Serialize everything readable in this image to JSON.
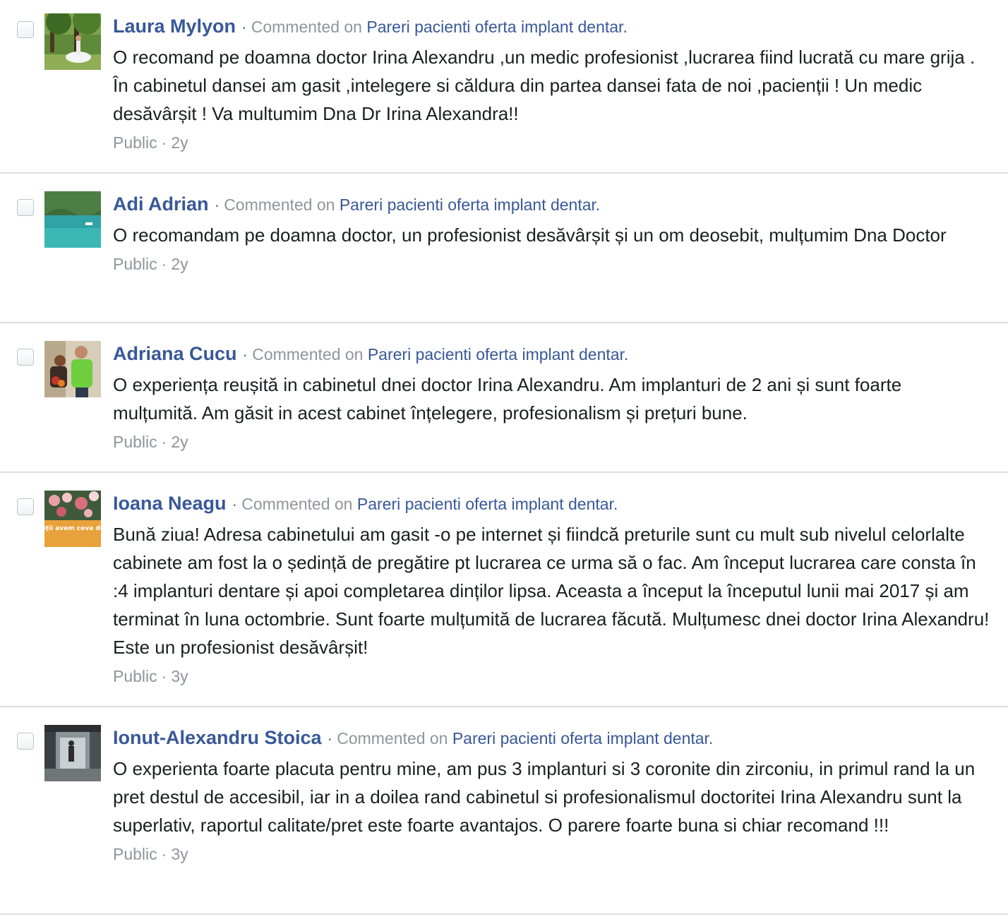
{
  "labels": {
    "commented_on": "Commented on",
    "separator": "·"
  },
  "comments": [
    {
      "author": "Laura Mylyon",
      "post_title": "Pareri pacienti oferta implant dentar.",
      "text": "O recomand pe doamna doctor Irina Alexandru ,un medic profesionist ,lucrarea fiind lucrată cu mare grija . În cabinetul dansei am gasit ,intelegere si căldura din partea dansei fata de noi ,pacienții ! Un medic desăvârșit ! Va multumim Dna Dr Irina Alexandra!!",
      "audience": "Public",
      "time": "2y",
      "avatar": "park-photo"
    },
    {
      "author": "Adi Adrian",
      "post_title": "Pareri pacienti oferta implant dentar.",
      "text": "O recomandam pe doamna doctor, un profesionist desăvârșit și un om deosebit, mulțumim Dna Doctor",
      "audience": "Public",
      "time": "2y",
      "avatar": "lake-photo"
    },
    {
      "author": "Adriana Cucu",
      "post_title": "Pareri pacienti oferta implant dentar.",
      "text": "O experiența reușită in cabinetul dnei doctor Irina Alexandru. Am implanturi de 2 ani și sunt foarte mulțumită. Am găsit in acest cabinet înțelegere, profesionalism și prețuri bune.",
      "audience": "Public",
      "time": "2y",
      "avatar": "couple-photo"
    },
    {
      "author": "Ioana Neagu",
      "post_title": "Pareri pacienti oferta implant dentar.",
      "text": "Bună ziua! Adresa cabinetului am gasit -o pe internet și fiindcă preturile sunt cu mult sub nivelul celorlalte cabinete am fost la o ședință de pregătire pt lucrarea ce urma să o fac. Am început lucrarea care consta în :4 implanturi dentare și apoi completarea dinților lipsa. Aceasta a început la începutul lunii mai 2017 și am terminat în luna octombrie. Sunt foarte mulțumită de lucrarea făcută. Mulțumesc dnei doctor Irina Alexandru! Este un profesionist desăvârșit!",
      "audience": "Public",
      "time": "3y",
      "avatar": "flowers-banner",
      "avatar_caption": "Cu toții avem ceva de dat"
    },
    {
      "author": "Ionut-Alexandru Stoica",
      "post_title": "Pareri pacienti oferta implant dentar.",
      "text": "O experienta foarte placuta pentru mine, am pus 3 implanturi si 3 coronite din zirconiu, in primul rand la un pret destul de accesibil, iar in a doilea rand cabinetul si profesionalismul doctoritei Irina Alexandru sunt la superlativ, raportul calitate/pret este foarte avantajos. O parere foarte buna si chiar recomand !!!",
      "audience": "Public",
      "time": "3y",
      "avatar": "corridor-photo"
    }
  ]
}
